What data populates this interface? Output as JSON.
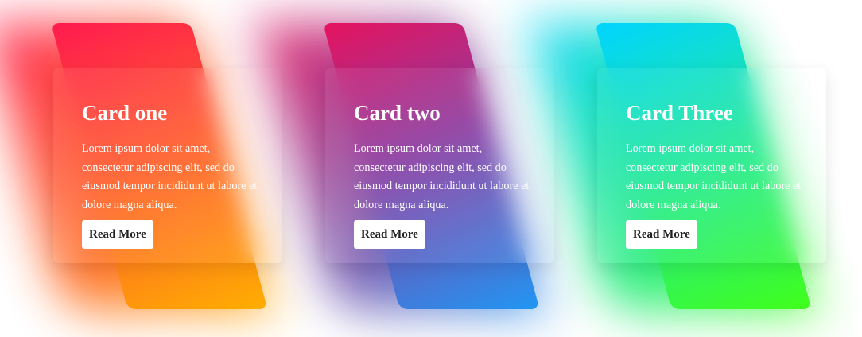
{
  "cards": [
    {
      "title": "Card one",
      "text": "Lorem ipsum dolor sit amet, consectetur adipiscing elit, sed do eiusmod tempor incididunt ut labore et dolore magna aliqua.",
      "button_label": "Read More",
      "gradient_start": "#ff1a4f",
      "gradient_end": "#ffae00"
    },
    {
      "title": "Card two",
      "text": "Lorem ipsum dolor sit amet, consectetur adipiscing elit, sed do eiusmod tempor incididunt ut labore et dolore magna aliqua.",
      "button_label": "Read More",
      "gradient_start": "#e6135f",
      "gradient_end": "#2196f3"
    },
    {
      "title": "Card Three",
      "text": "Lorem ipsum dolor sit amet, consectetur adipiscing elit, sed do eiusmod tempor incididunt ut labore et dolore magna aliqua.",
      "button_label": "Read More",
      "gradient_start": "#00d4ff",
      "gradient_end": "#40ff1a"
    }
  ]
}
